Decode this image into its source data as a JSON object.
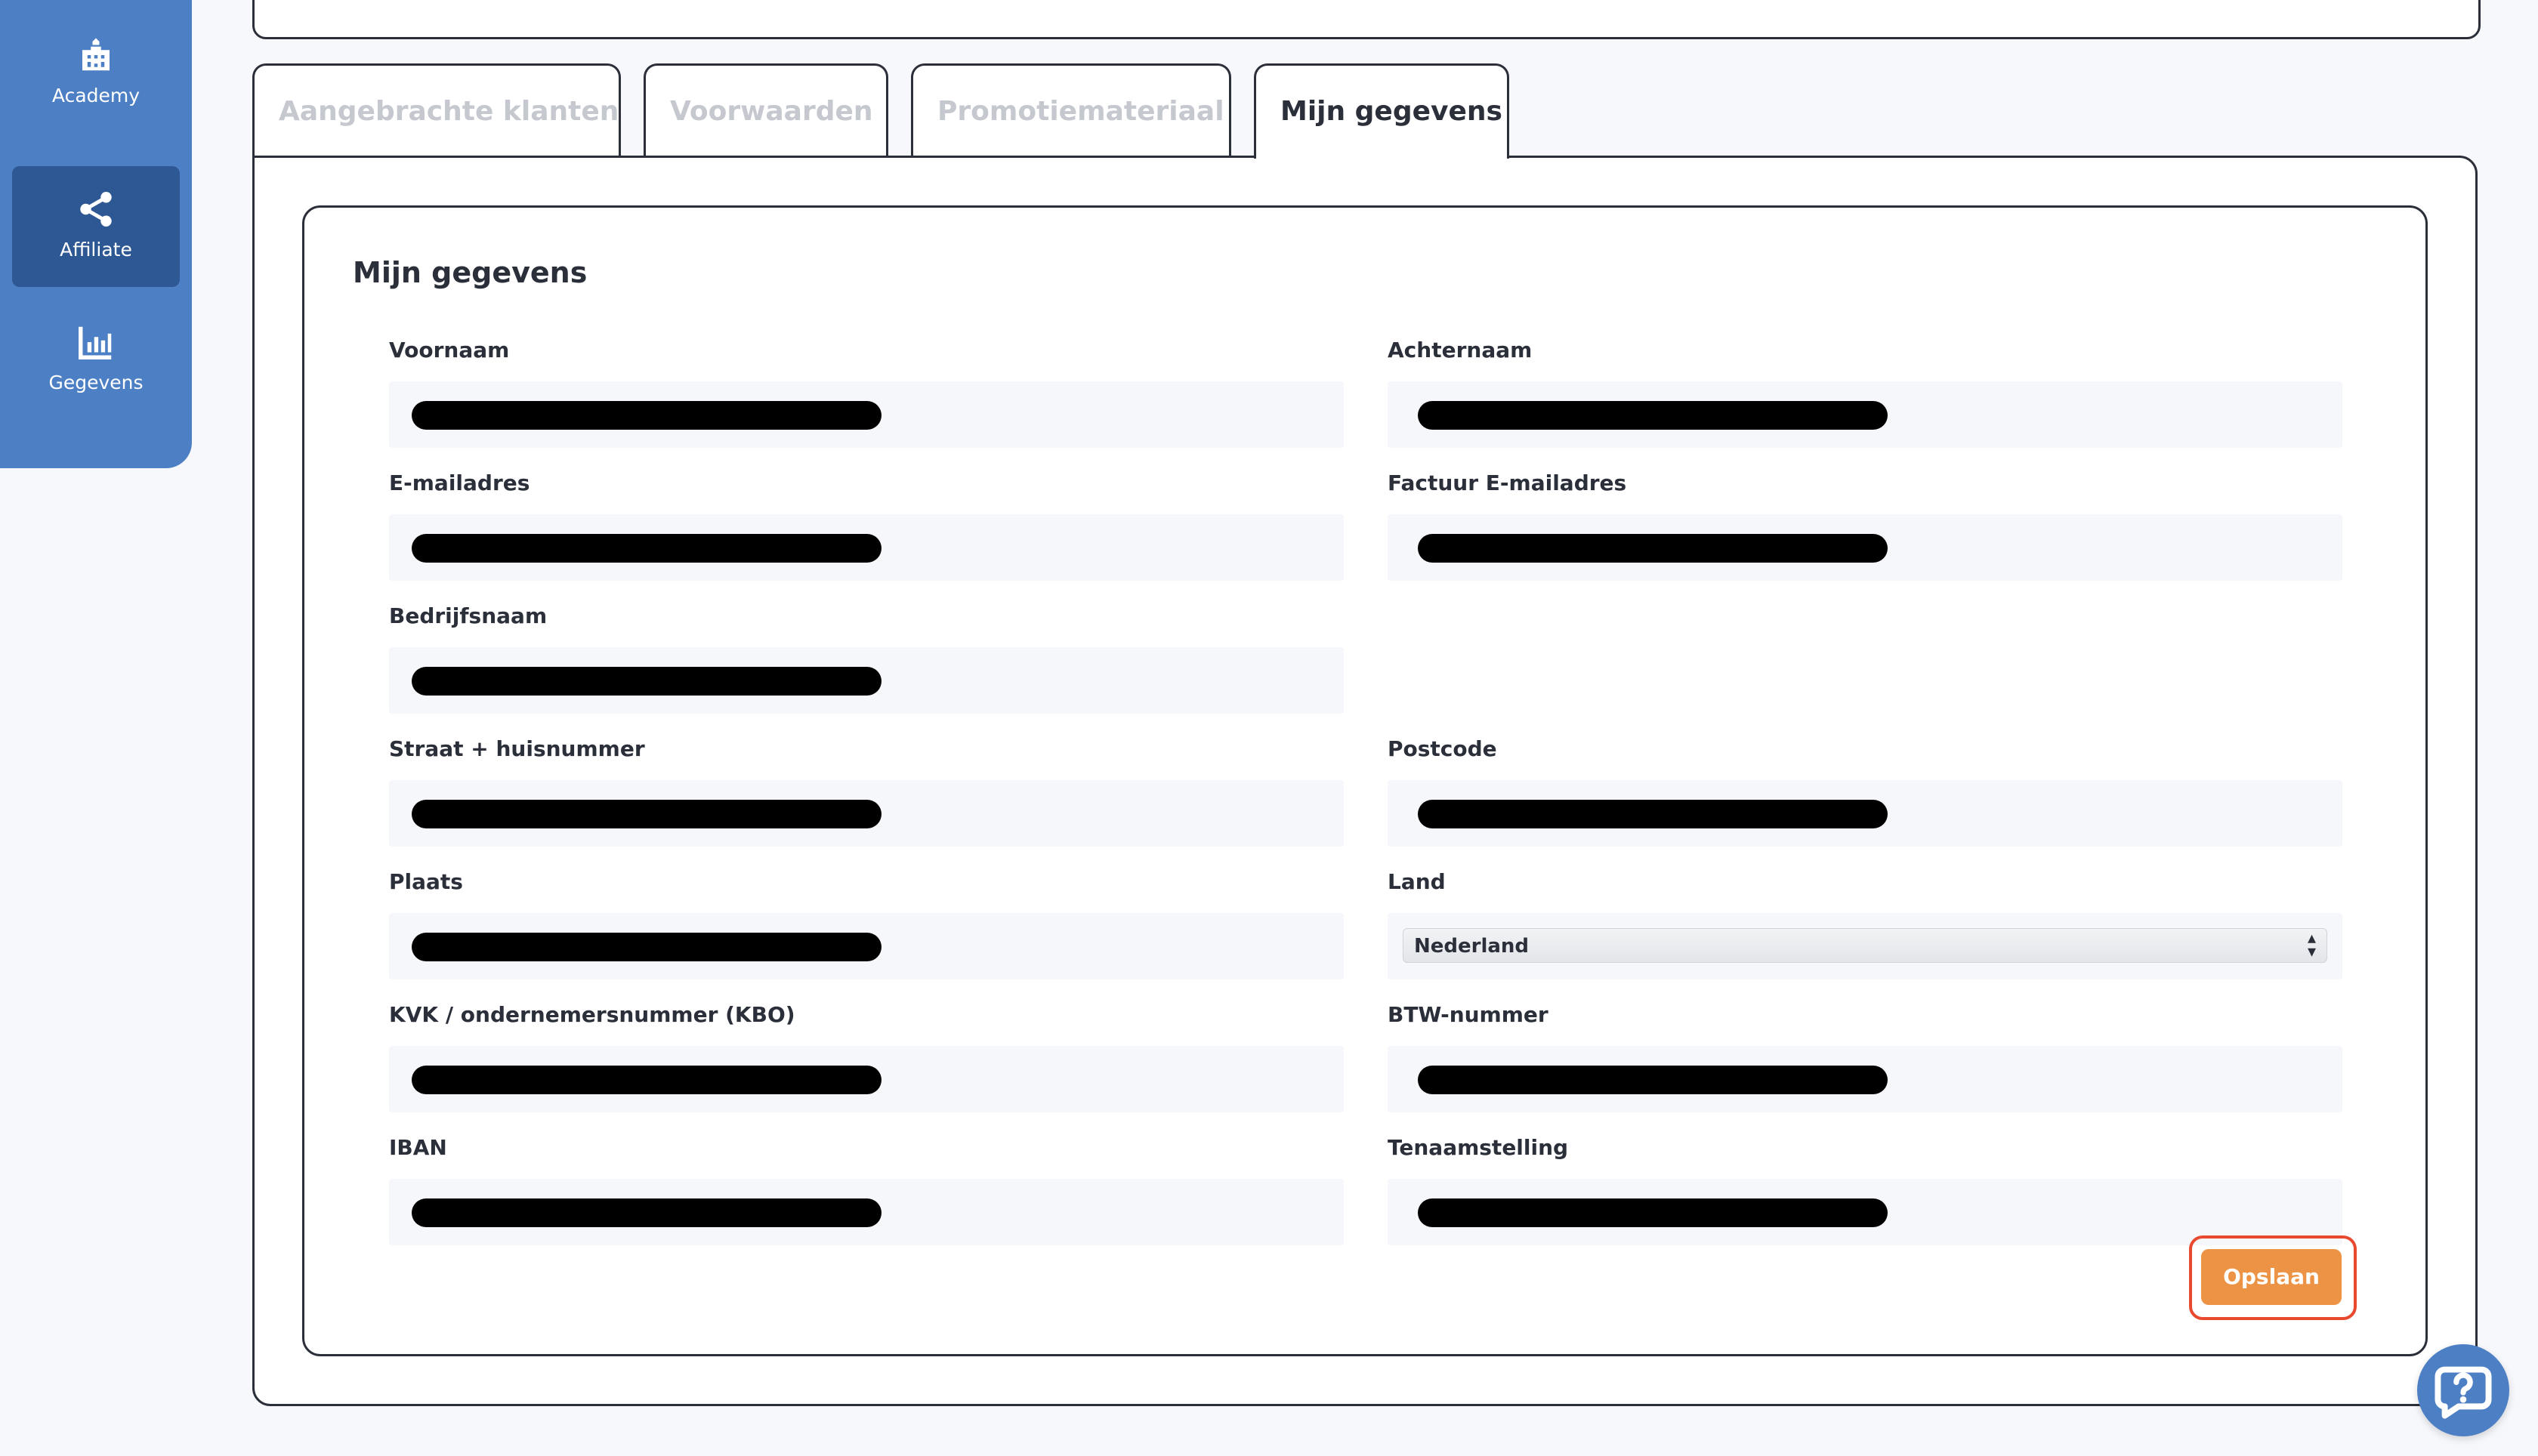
{
  "sidebar": {
    "items": [
      {
        "label": "Academy",
        "icon": "academy-building-icon",
        "active": false
      },
      {
        "label": "Affiliate",
        "icon": "share-icon",
        "active": true
      },
      {
        "label": "Gegevens",
        "icon": "bar-chart-icon",
        "active": false
      }
    ]
  },
  "tabs": [
    {
      "label": "Aangebrachte klanten",
      "active": false
    },
    {
      "label": "Voorwaarden",
      "active": false
    },
    {
      "label": "Promotiemateriaal",
      "active": false
    },
    {
      "label": "Mijn gegevens",
      "active": true
    }
  ],
  "form": {
    "title": "Mijn gegevens",
    "fields": {
      "voornaam": {
        "label": "Voornaam"
      },
      "achternaam": {
        "label": "Achternaam"
      },
      "email": {
        "label": "E-mailadres"
      },
      "factuur_email": {
        "label": "Factuur E-mailadres"
      },
      "bedrijfsnaam": {
        "label": "Bedrijfsnaam"
      },
      "straat": {
        "label": "Straat + huisnummer"
      },
      "postcode": {
        "label": "Postcode"
      },
      "plaats": {
        "label": "Plaats"
      },
      "land": {
        "label": "Land",
        "value": "Nederland"
      },
      "kvk": {
        "label": "KVK / ondernemersnummer (KBO)"
      },
      "btw": {
        "label": "BTW-nummer"
      },
      "iban": {
        "label": "IBAN"
      },
      "tenaamstelling": {
        "label": "Tenaamstelling"
      }
    },
    "save_label": "Opslaan"
  },
  "colors": {
    "sidebar": "#4d7fc4",
    "sidebar_active": "#2d5894",
    "save_button": "#ec9346",
    "highlight_outline": "#e8492f"
  },
  "chat": {
    "icon": "chat-help-icon"
  }
}
